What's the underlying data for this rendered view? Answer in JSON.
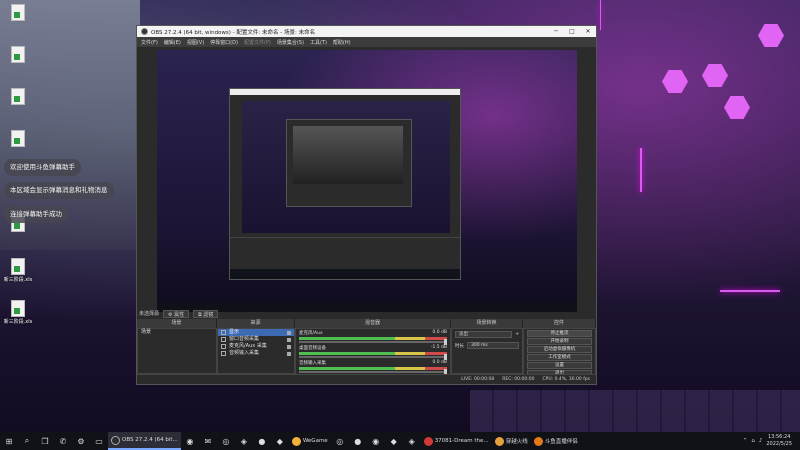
{
  "desktop": {
    "icons": [
      {
        "label": "",
        "type": "file"
      },
      {
        "label": "",
        "type": "file"
      },
      {
        "label": "",
        "type": "file"
      },
      {
        "label": "",
        "type": "file"
      },
      {
        "label": "",
        "type": "file"
      },
      {
        "label": "新三阶段.xls",
        "type": "file"
      },
      {
        "label": "新三阶段.xls",
        "type": "file"
      }
    ],
    "notifications": [
      "欢迎使用斗鱼弹幕助手",
      "本区域会显示弹幕消息和礼物消息",
      "连接弹幕助手成功"
    ]
  },
  "obs": {
    "title": "OBS 27.2.4 (64 bit, windows) - 配置文件: 未命名 - 场景: 未命名",
    "menu": [
      "文件(F)",
      "编辑(E)",
      "视图(V)",
      "停靠窗口(D)",
      "配置文件(P)",
      "场景集合(S)",
      "工具(T)",
      "帮助(H)"
    ],
    "menu_disabled_index": 4,
    "scene_bar": {
      "label": "未选择源",
      "props": "属性",
      "filters": "滤镜"
    },
    "dock_titles": [
      "场景",
      "来源",
      "混音器",
      "场景转换",
      "控件"
    ],
    "scenes": [
      "场景"
    ],
    "sources": [
      "显示",
      "窗口音频采集",
      "麦克风/Aux 采集",
      "音频输入采集"
    ],
    "mixer": [
      {
        "name": "麦克风/Aux",
        "db": "0.0 dB"
      },
      {
        "name": "桌面音频设备",
        "db": "-1.5 dB"
      },
      {
        "name": "音频输入采集",
        "db": "0.0 dB"
      }
    ],
    "transition": {
      "type": "淡出",
      "duration_label": "时长",
      "duration": "300 ms"
    },
    "controls": [
      "停止推流",
      "开始录制",
      "启动虚拟摄像机",
      "工作室模式",
      "设置",
      "退出"
    ],
    "status": {
      "live": "LIVE: 00:00:08",
      "rec": "REC: 00:00:00",
      "cpu": "CPU: 0.4%, 30.00 fps"
    }
  },
  "taskbar": {
    "apps": [
      {
        "label": "OBS 27.2.4 (64 bit...",
        "color": "#2c2c2c",
        "active": true
      },
      {
        "label": "WeGame",
        "color": "#f2b23a",
        "active": false
      },
      {
        "label": "37081-Dream the...",
        "color": "#d23a3a",
        "active": false
      },
      {
        "label": "穿越火线",
        "color": "#e6a23c",
        "active": false
      },
      {
        "label": "斗鱼直播伴侣",
        "color": "#e37b1c",
        "active": false
      }
    ],
    "time": "13:56:24",
    "date": "2022/5/25"
  }
}
